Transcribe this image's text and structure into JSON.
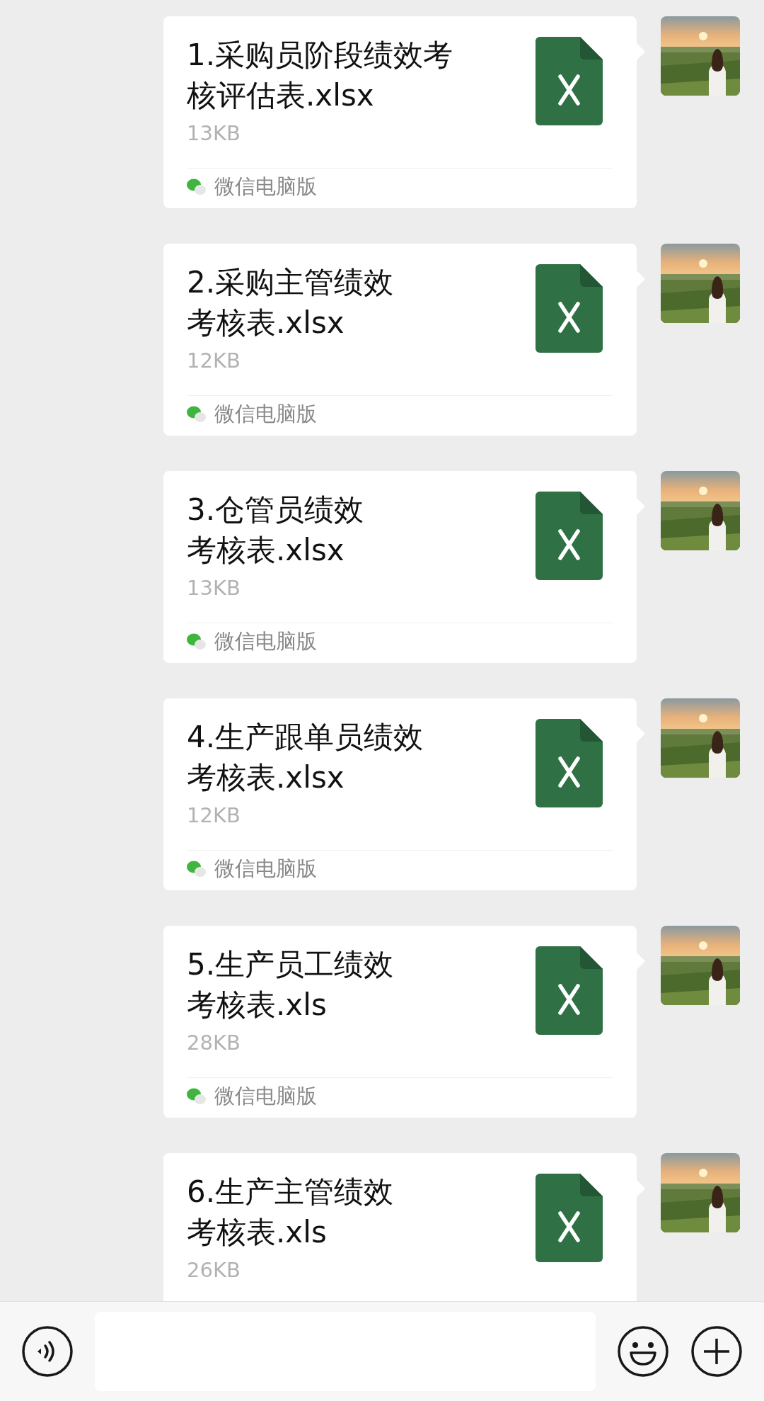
{
  "messages": [
    {
      "title_lines": [
        "1.采购员阶段绩效考",
        "核评估表.xlsx"
      ],
      "size": "13KB",
      "source": "微信电脑版"
    },
    {
      "title_lines": [
        "2.采购主管绩效",
        "考核表.xlsx"
      ],
      "size": "12KB",
      "source": "微信电脑版"
    },
    {
      "title_lines": [
        "3.仓管员绩效",
        "考核表.xlsx"
      ],
      "size": "13KB",
      "source": "微信电脑版"
    },
    {
      "title_lines": [
        "4.生产跟单员绩效",
        "考核表.xlsx"
      ],
      "size": "12KB",
      "source": "微信电脑版"
    },
    {
      "title_lines": [
        "5.生产员工绩效",
        "考核表.xls"
      ],
      "size": "28KB",
      "source": "微信电脑版"
    },
    {
      "title_lines": [
        "6.生产主管绩效",
        "考核表.xls"
      ],
      "size": "26KB"
    }
  ],
  "input": {
    "kind": "text"
  }
}
